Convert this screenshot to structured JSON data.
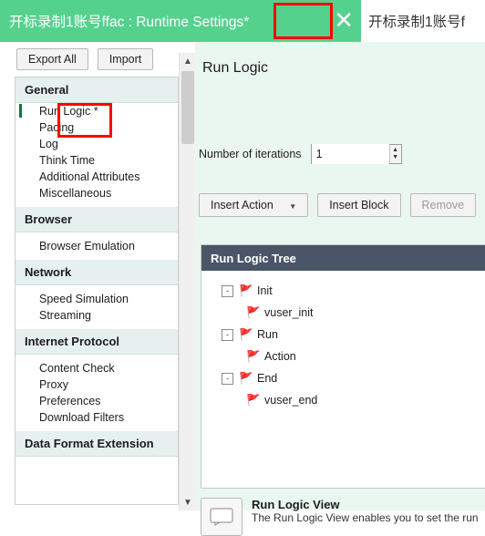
{
  "window": {
    "active_tab_title": "开标录制1账号ffac : Runtime Settings*",
    "close_icon": "close-icon",
    "inactive_tab_title": "开标录制1账号f"
  },
  "left": {
    "buttons": {
      "export_all": "Export All",
      "import": "Import"
    },
    "tree": [
      {
        "type": "category",
        "label": "General"
      },
      {
        "type": "item",
        "label": "Run Logic *",
        "selected": true
      },
      {
        "type": "item",
        "label": "Pacing"
      },
      {
        "type": "item",
        "label": "Log"
      },
      {
        "type": "item",
        "label": "Think Time"
      },
      {
        "type": "item",
        "label": "Additional Attributes"
      },
      {
        "type": "item",
        "label": "Miscellaneous"
      },
      {
        "type": "category",
        "label": "Browser"
      },
      {
        "type": "item",
        "label": "Browser Emulation"
      },
      {
        "type": "category",
        "label": "Network"
      },
      {
        "type": "item",
        "label": "Speed Simulation"
      },
      {
        "type": "item",
        "label": "Streaming"
      },
      {
        "type": "category",
        "label": "Internet Protocol"
      },
      {
        "type": "item",
        "label": "Content Check"
      },
      {
        "type": "item",
        "label": "Proxy"
      },
      {
        "type": "item",
        "label": "Preferences"
      },
      {
        "type": "item",
        "label": "Download Filters"
      },
      {
        "type": "category",
        "label": "Data Format Extension"
      }
    ]
  },
  "right": {
    "title": "Run Logic",
    "iterations_label": "Number of iterations",
    "iterations_value": "1",
    "buttons": {
      "insert_action": "Insert Action",
      "insert_block": "Insert Block",
      "remove": "Remove"
    },
    "tree_header": "Run Logic Tree",
    "tree": [
      {
        "label": "Init",
        "expander": "-",
        "children": [
          "vuser_init"
        ]
      },
      {
        "label": "Run",
        "expander": "-",
        "children": [
          "Action"
        ]
      },
      {
        "label": "End",
        "expander": "-",
        "children": [
          "vuser_end"
        ]
      }
    ],
    "info": {
      "title": "Run Logic View",
      "text": "The Run Logic View enables you to set the run"
    }
  },
  "scrollbar": {
    "up_arrow": "chevron-up-icon",
    "down_arrow": "chevron-down-icon"
  },
  "colors": {
    "accent": "#55d18e",
    "panel": "#eaf7f0",
    "header": "#4a5568",
    "annotation": "#ff0000"
  }
}
